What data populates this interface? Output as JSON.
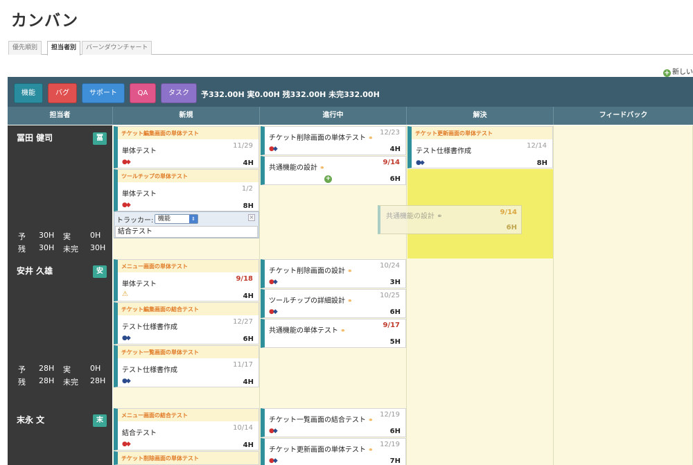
{
  "title": "カンバン",
  "tabs": [
    "優先順別",
    "担当者別",
    "バーンダウンチャート"
  ],
  "new_link": "新しい",
  "toolbar": {
    "buttons": [
      {
        "label": "機能",
        "color": "#2a8d9f"
      },
      {
        "label": "バグ",
        "color": "#e0504f"
      },
      {
        "label": "サポート",
        "color": "#3e8ed8"
      },
      {
        "label": "QA",
        "color": "#e0568a"
      },
      {
        "label": "タスク",
        "color": "#8c72c8"
      }
    ],
    "summary": "予332.00H 実0.00H 残332.00H 未完332.00H"
  },
  "columns": [
    "担当者",
    "新規",
    "進行中",
    "解決",
    "フィードバック"
  ],
  "lanes": [
    {
      "name": "冨田 健司",
      "avatar": "冨",
      "row1": [
        "予",
        "30H",
        "実",
        "0H"
      ],
      "row2": [
        "残",
        "30H",
        "未完",
        "30H"
      ],
      "new": [
        {
          "cat": "チケット編集画面の単体テスト",
          "title": "単体テスト",
          "date": "11/29",
          "hours": "4H",
          "overdue": false
        },
        {
          "cat": "ツールチップの単体テスト",
          "title": "単体テスト",
          "date": "1/2",
          "hours": "8H",
          "overdue": false
        }
      ],
      "form": {
        "tracker_label": "トラッカー:",
        "tracker_value": "機能",
        "text": "結合テスト"
      },
      "progress": [
        {
          "title": "チケット削除画面の単体テスト",
          "date": "12/23",
          "hours": "4H",
          "overdue": false
        },
        {
          "title": "共通機能の設計",
          "date": "9/14",
          "hours": "6H",
          "overdue": true
        }
      ],
      "resolved": [
        {
          "cat": "チケット更新画面の単体テスト",
          "title": "テスト仕様書作成",
          "date": "12/14",
          "hours": "8H",
          "overdue": false
        }
      ],
      "ghost": {
        "title": "共通機能の設計",
        "date": "9/14",
        "hours": "6H"
      }
    },
    {
      "name": "安井 久雄",
      "avatar": "安",
      "row1": [
        "予",
        "28H",
        "実",
        "0H"
      ],
      "row2": [
        "残",
        "28H",
        "未完",
        "28H"
      ],
      "new": [
        {
          "cat": "メニュー画面の単体テスト",
          "title": "単体テスト",
          "date": "9/18",
          "hours": "4H",
          "overdue": true
        },
        {
          "cat": "チケット編集画面の結合テスト",
          "title": "テスト仕様書作成",
          "date": "12/27",
          "hours": "6H",
          "overdue": false
        },
        {
          "cat": "チケット一覧画面の単体テスト",
          "title": "テスト仕様書作成",
          "date": "11/17",
          "hours": "4H",
          "overdue": false
        }
      ],
      "progress": [
        {
          "title": "チケット削除画面の設計",
          "date": "10/24",
          "hours": "3H",
          "overdue": false
        },
        {
          "title": "ツールチップの詳細設計",
          "date": "10/25",
          "hours": "6H",
          "overdue": false
        },
        {
          "title": "共通機能の単体テスト",
          "date": "9/17",
          "hours": "5H",
          "overdue": true
        }
      ]
    },
    {
      "name": "末永 文",
      "avatar": "末",
      "new": [
        {
          "cat": "メニュー画面の結合テスト",
          "title": "結合テスト",
          "date": "10/14",
          "hours": "4H",
          "overdue": false
        },
        {
          "cat": "チケット削除画面の単体テスト",
          "title": "",
          "date": "",
          "hours": "",
          "overdue": false
        }
      ],
      "progress": [
        {
          "title": "チケット一覧画面の結合テスト",
          "date": "12/19",
          "hours": "6H",
          "overdue": false
        },
        {
          "title": "チケット更新画面の単体テスト",
          "date": "12/19",
          "hours": "7H",
          "overdue": false
        }
      ]
    }
  ]
}
